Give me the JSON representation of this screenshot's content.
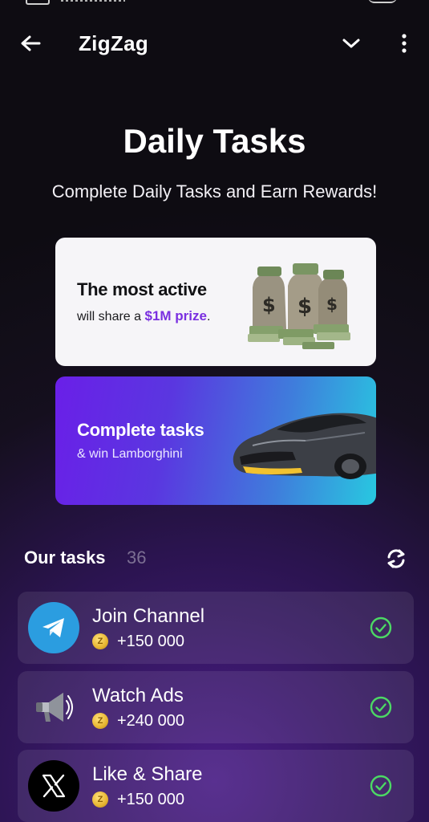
{
  "header": {
    "title": "ZigZag"
  },
  "hero": {
    "title": "Daily Tasks",
    "subtitle": "Complete Daily Tasks and Earn Rewards!"
  },
  "banners": {
    "prize": {
      "title": "The most active",
      "line_prefix": "will share a ",
      "amount": "$1M prize",
      "line_suffix": "."
    },
    "car": {
      "title": "Complete tasks",
      "subtitle": "& win Lamborghini"
    }
  },
  "tasks_section": {
    "title": "Our tasks",
    "count": "36"
  },
  "tasks": [
    {
      "name": "Join Channel",
      "reward": "+150 000",
      "icon": "telegram-icon",
      "completed": true
    },
    {
      "name": "Watch Ads",
      "reward": "+240 000",
      "icon": "megaphone-icon",
      "completed": true
    },
    {
      "name": "Like & Share",
      "reward": "+150 000",
      "icon": "x-logo-icon",
      "completed": true
    }
  ],
  "colors": {
    "accent_purple": "#7a2fe0",
    "check_green": "#4cd964",
    "coin_gold": "#e7b531"
  }
}
